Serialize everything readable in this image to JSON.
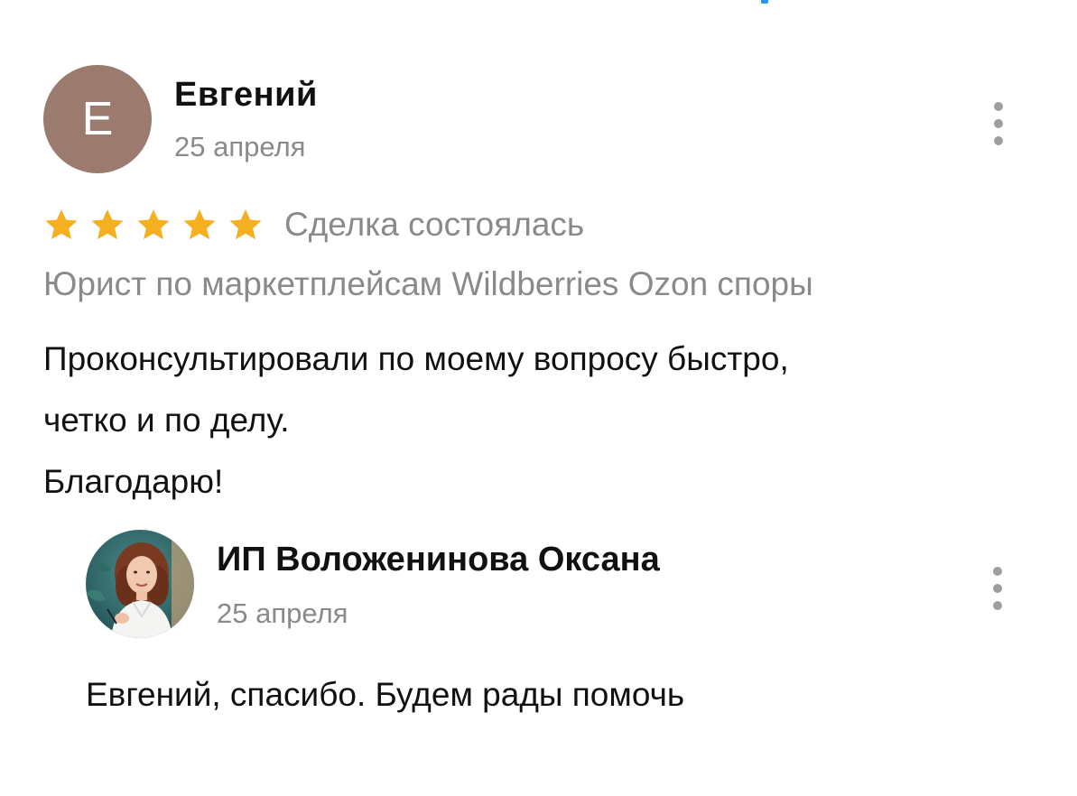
{
  "review": {
    "avatar_letter": "Е",
    "author": "Евгений",
    "date": "25 апреля",
    "rating": 5,
    "rating_max": 5,
    "deal_status": "Сделка состоялась",
    "service": "Юрист по маркетплейсам Wildberries Ozon споры",
    "text_lines": [
      "Проконсультировали по моему вопросу быстро,",
      "четко и по делу.",
      "Благодарю!"
    ]
  },
  "reply": {
    "author": "ИП Воложенинова Оксана",
    "date": "25 апреля",
    "text": "Евгений, спасибо. Будем рады помочь"
  },
  "colors": {
    "star": "#f5b021",
    "avatar_bg": "#9a7b6e",
    "muted_text": "#8a8a8a",
    "accent": "#2196f3"
  },
  "icons": {
    "more": "more-vertical-icon",
    "star": "star-icon"
  }
}
